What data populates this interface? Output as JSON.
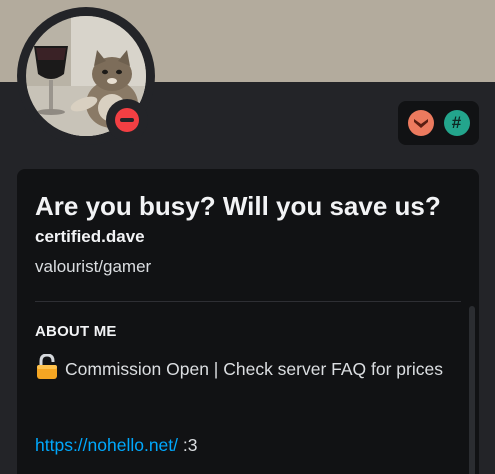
{
  "profile": {
    "display_name": "Are you busy? Will you save us?",
    "username": "certified.dave",
    "pronouns": "valourist/gamer",
    "status": "do-not-disturb",
    "avatar_icon": "cat-with-wine-glass-avatar"
  },
  "badges": [
    {
      "name": "hypesquad-badge",
      "color": "#ec7a5e"
    },
    {
      "name": "active-developer-badge",
      "color": "#23a58c",
      "glyph": "#"
    }
  ],
  "about": {
    "title": "ABOUT ME",
    "bio_text": "Commission Open | Check server FAQ for prices",
    "link_text": "https://nohello.net/",
    "link_suffix": " :3"
  },
  "colors": {
    "banner": "#b3ab9d",
    "background": "#232428",
    "card": "#111214",
    "link": "#00a8fc",
    "dnd": "#f23f43"
  }
}
